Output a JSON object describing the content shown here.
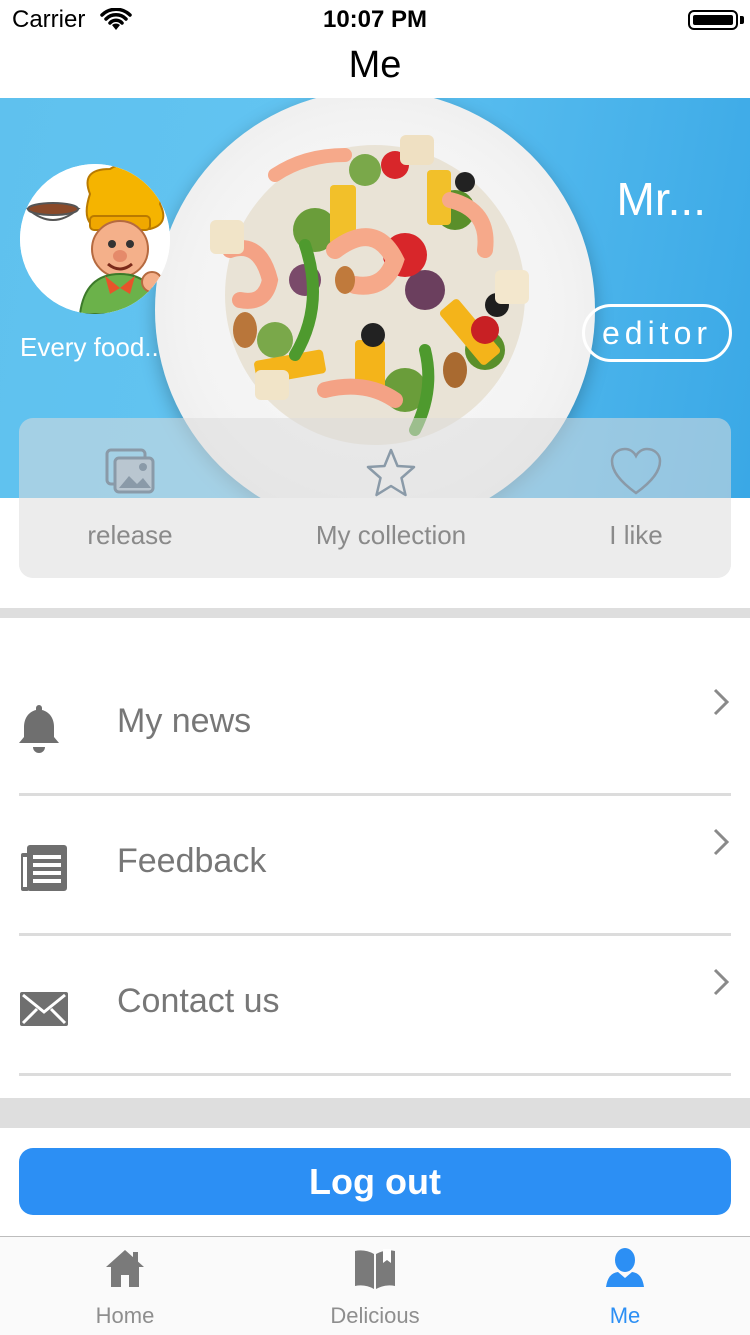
{
  "status_bar": {
    "carrier": "Carrier",
    "time": "10:07 PM"
  },
  "nav": {
    "title": "Me"
  },
  "profile": {
    "name": "Mr...",
    "bio": "Every food..",
    "editor_label": "editor"
  },
  "actions": [
    {
      "label": "release",
      "icon": "image-gallery-icon"
    },
    {
      "label": "My collection",
      "icon": "star-icon"
    },
    {
      "label": "I like",
      "icon": "heart-icon"
    }
  ],
  "menu": [
    {
      "label": "My news",
      "icon": "bell-icon"
    },
    {
      "label": "Feedback",
      "icon": "document-list-icon"
    },
    {
      "label": "Contact us",
      "icon": "envelope-icon"
    }
  ],
  "logout_label": "Log out",
  "tabs": [
    {
      "label": "Home",
      "icon": "home-icon"
    },
    {
      "label": "Delicious",
      "icon": "book-icon"
    },
    {
      "label": "Me",
      "icon": "person-icon",
      "active": true
    }
  ],
  "colors": {
    "accent": "#2c8ff4",
    "banner": "#5fc1ee",
    "text_secondary": "#777777"
  }
}
